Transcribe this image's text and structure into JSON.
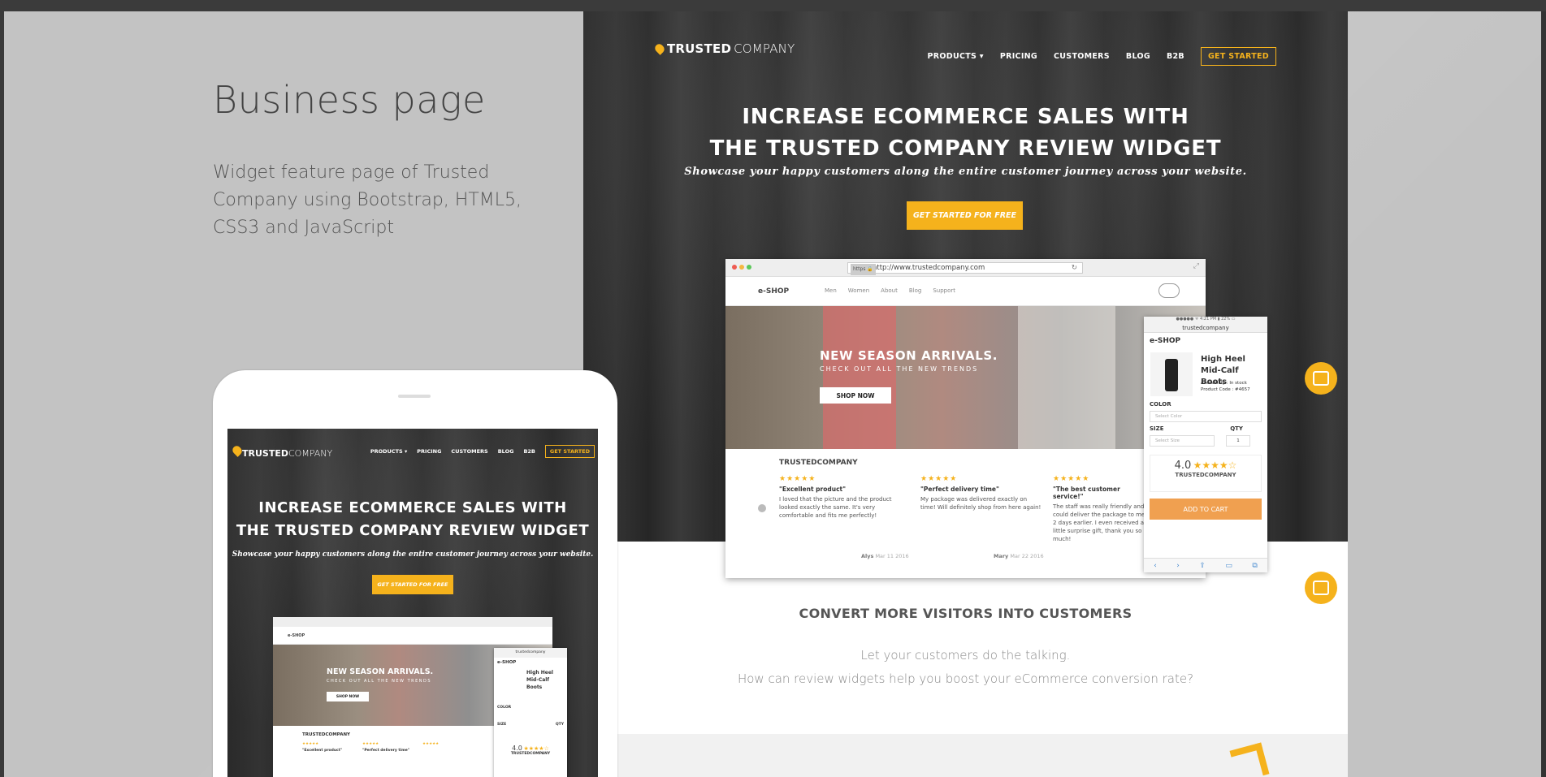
{
  "project": {
    "title": "Business page",
    "description": "Widget feature page of Trusted Company using Bootstrap, HTML5, CSS3 and JavaScript"
  },
  "site": {
    "logo_bold": "TRUSTED",
    "logo_light": "COMPANY",
    "nav": [
      "PRODUCTS ▾",
      "PRICING",
      "CUSTOMERS",
      "BLOG",
      "B2B"
    ],
    "nav_cta": "GET STARTED",
    "headline_1": "INCREASE ECOMMERCE SALES WITH",
    "headline_2": "THE TRUSTED COMPANY REVIEW WIDGET",
    "subtitle": "Showcase your happy customers along the entire customer journey across your website.",
    "hero_button": "GET STARTED FOR FREE",
    "section_title": "CONVERT MORE VISITORS INTO CUSTOMERS",
    "section_line_1": "Let your customers do the talking.",
    "section_line_2": "How can review widgets help you boost your eCommerce conversion rate?"
  },
  "browser": {
    "https": "https 🔒",
    "url": "http://www.trustedcompany.com",
    "shop_brand": "e-SHOP",
    "shop_links": [
      "Men",
      "Women",
      "About",
      "Blog",
      "Support"
    ],
    "banner_title": "NEW SEASON ARRIVALS.",
    "banner_sub": "CHECK OUT ALL THE NEW TRENDS",
    "banner_button": "SHOP NOW",
    "reviews_logo": "TRUSTEDCOMPANY",
    "reviews": [
      {
        "stars": "★★★★★",
        "title": "\"Excellent product\"",
        "text": "I loved that the picture and the product looked exactly the same. It's very comfortable and fits me perfectly!",
        "author": "Alys",
        "date": "Mar 11 2016"
      },
      {
        "stars": "★★★★★",
        "title": "\"Perfect delivery time\"",
        "text": "My package was delivered exactly on time! Will definitely shop from here again!",
        "author": "Mary",
        "date": "Mar 22 2016"
      },
      {
        "stars": "★★★★★",
        "title": "\"The best customer service!\"",
        "text": "The staff was really friendly and could deliver the package to me 2 days earlier. I even received a little surprise gift, thank you so much!",
        "author": "",
        "date": ""
      }
    ]
  },
  "phone": {
    "status": "●●●●● ᯤ     4:21 PM     ▮ 22% ▭",
    "url": "trustedcompany",
    "brand": "e-SHOP",
    "product_line_1": "High Heel",
    "product_line_2": "Mid-Calf Boots",
    "availability": "Availability : In stock",
    "code": "Product Code : #4657",
    "color_label": "COLOR",
    "color_placeholder": "Select Color",
    "size_label": "SIZE",
    "qty_label": "QTY",
    "size_placeholder": "Select Size",
    "qty_value": "1",
    "score": "4.0",
    "score_stars": "★★★★☆",
    "score_logo": "TRUSTEDCOMPANY",
    "add_to_cart": "ADD TO CART"
  },
  "colors": {
    "accent": "#f5b21c",
    "cart": "#f0a050"
  }
}
